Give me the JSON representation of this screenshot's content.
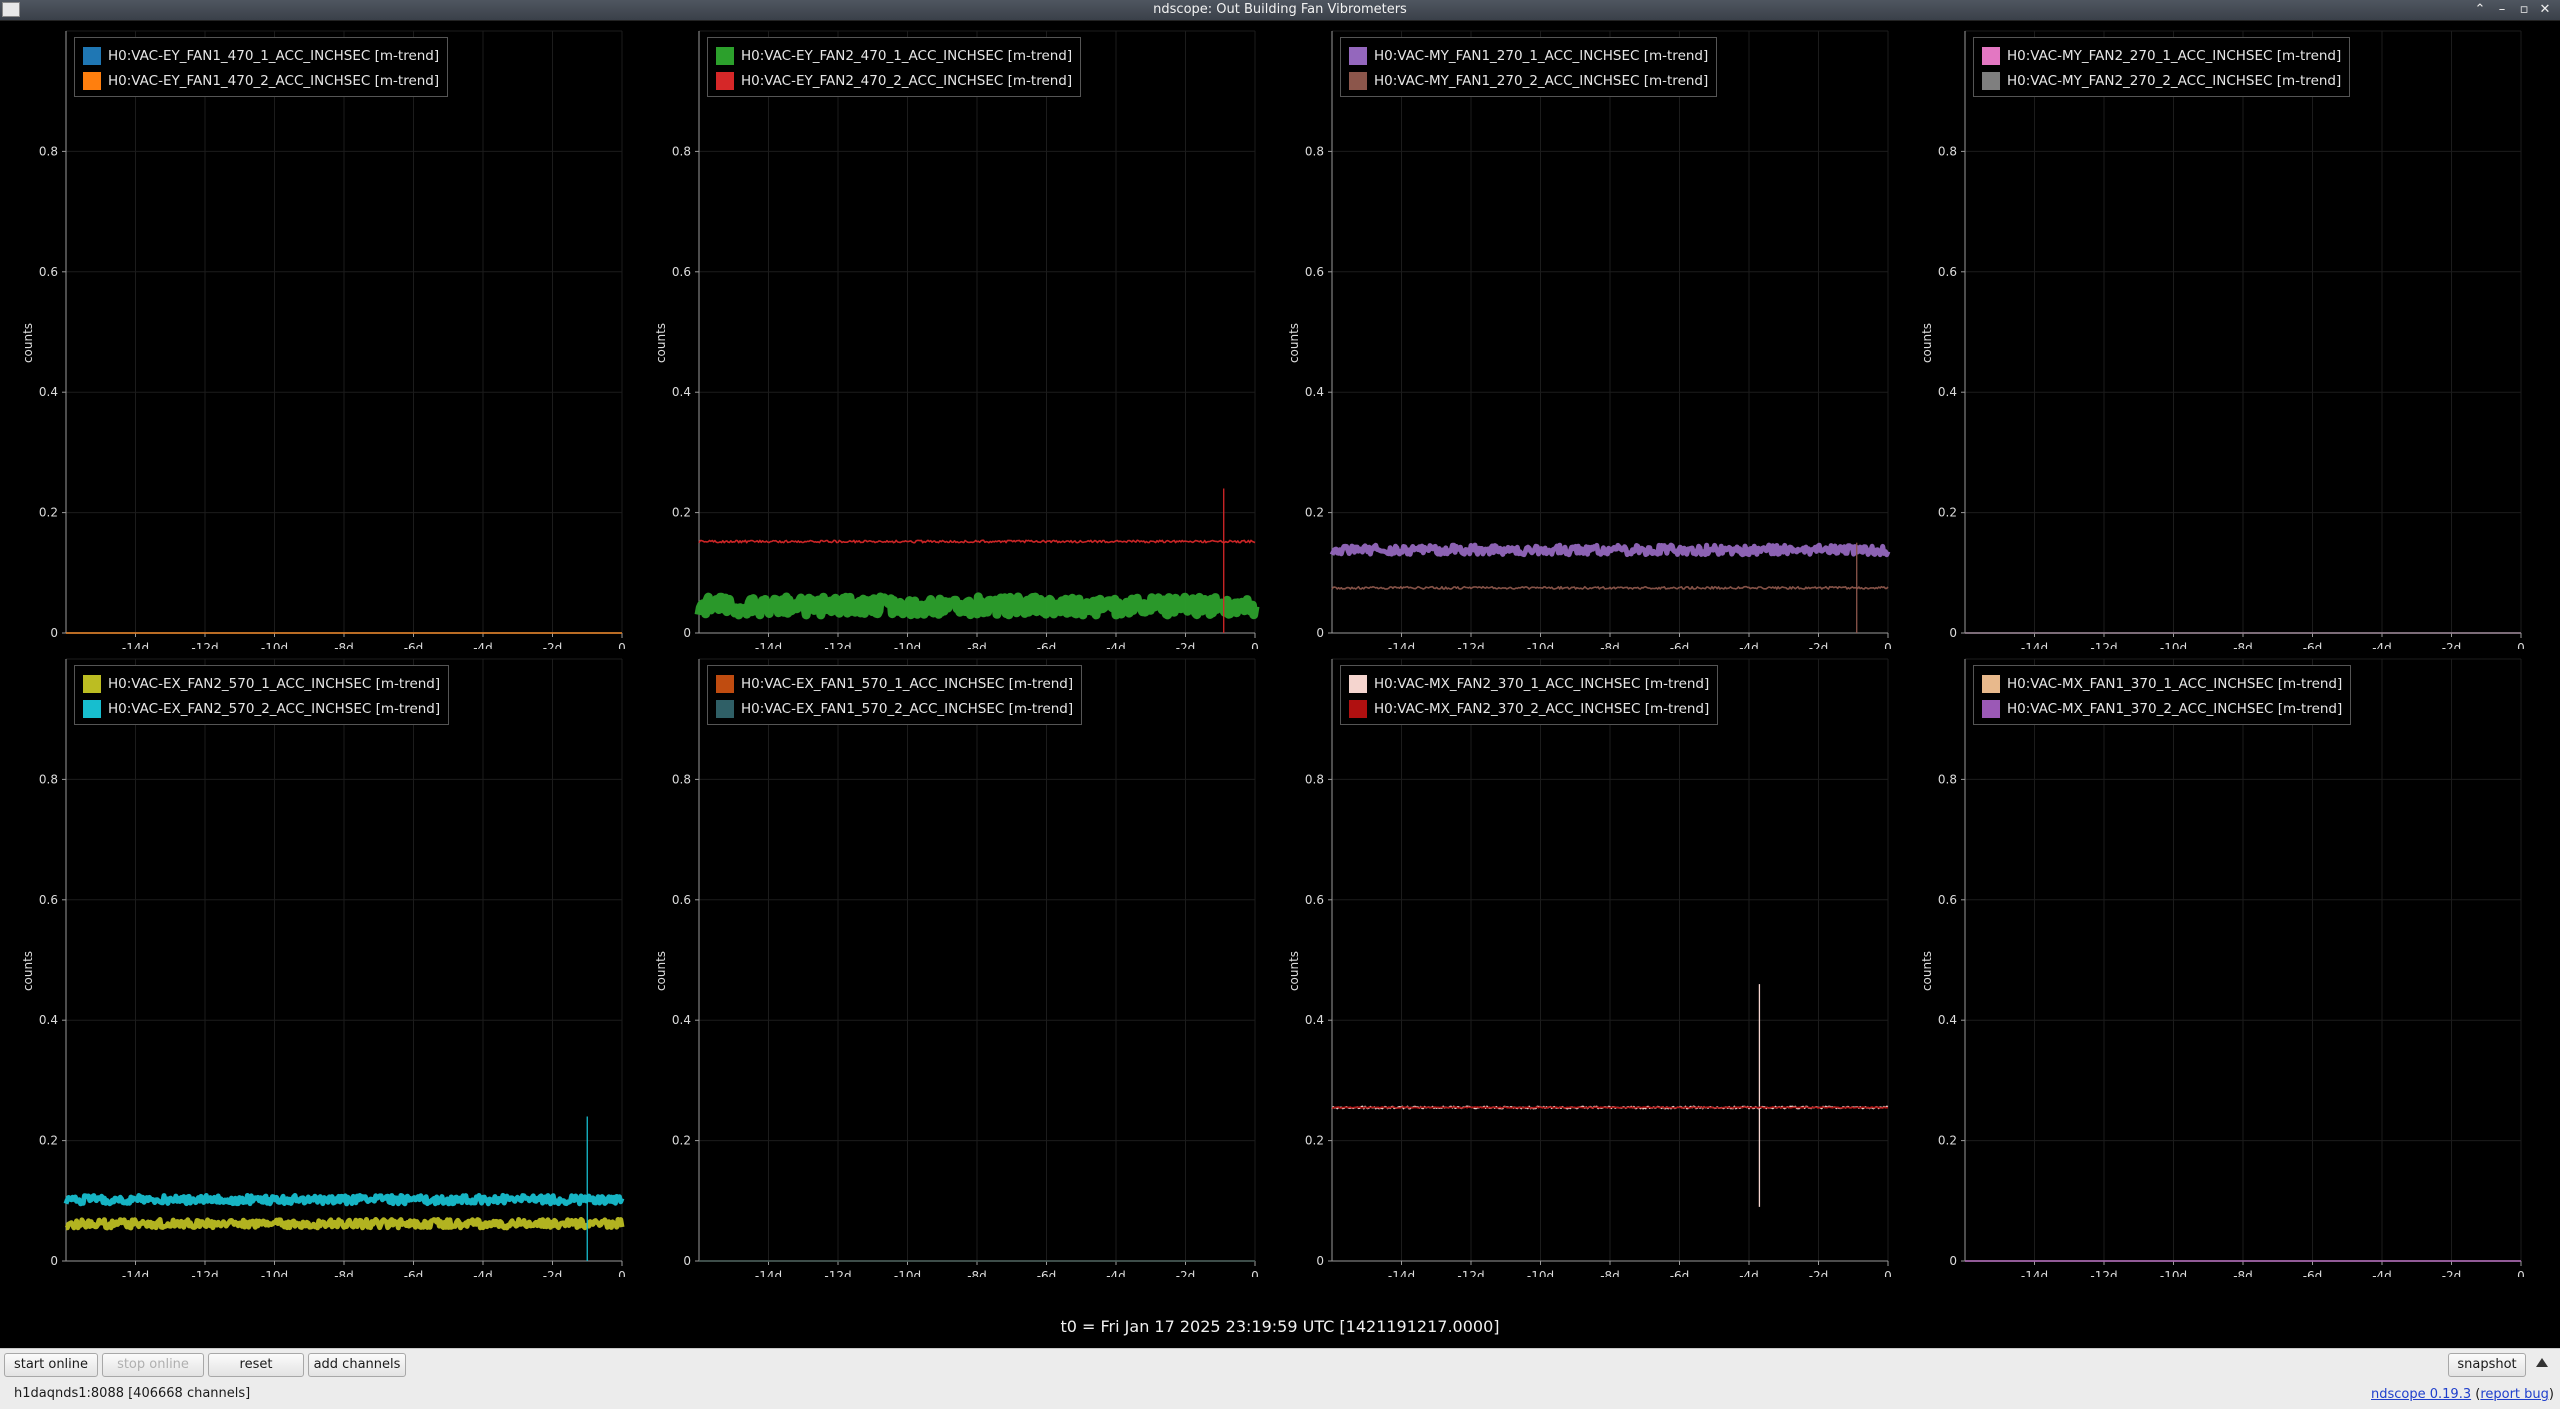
{
  "window": {
    "title": "ndscope: Out Building Fan Vibrometers"
  },
  "axes": {
    "ylabel": "counts",
    "ylim": [
      0,
      1.0
    ],
    "yticks": [
      "0",
      "0.2",
      "0.4",
      "0.6",
      "0.8"
    ],
    "xlim_days": [
      -16,
      0
    ],
    "xticks": [
      "-14d",
      "-12d",
      "-10d",
      "-8d",
      "-6d",
      "-4d",
      "-2d",
      "0"
    ]
  },
  "chart_data": [
    {
      "type": "line",
      "ylabel": "counts",
      "ylim": [
        0,
        1.0
      ],
      "x_range": [
        "-16d",
        "0"
      ],
      "series": [
        {
          "name": "H0:VAC-EY_FAN1_470_1_ACC_INCHSEC [m-trend]",
          "color": "#1f77b4",
          "level": 0.0,
          "noise": 0,
          "spike": null
        },
        {
          "name": "H0:VAC-EY_FAN1_470_2_ACC_INCHSEC [m-trend]",
          "color": "#ff7f0e",
          "level": 0.0,
          "noise": 0,
          "spike": null
        }
      ]
    },
    {
      "type": "line",
      "ylabel": "counts",
      "ylim": [
        0,
        1.0
      ],
      "x_range": [
        "-16d",
        "0"
      ],
      "series": [
        {
          "name": "H0:VAC-EY_FAN2_470_1_ACC_INCHSEC [m-trend]",
          "color": "#2ca02c",
          "level": 0.045,
          "noise": 0.015,
          "spike": null
        },
        {
          "name": "H0:VAC-EY_FAN2_470_2_ACC_INCHSEC [m-trend]",
          "color": "#d62728",
          "level": 0.152,
          "noise": 0.002,
          "spike": {
            "x": -0.9,
            "y0": 0.0,
            "y1": 0.24
          }
        }
      ]
    },
    {
      "type": "line",
      "ylabel": "counts",
      "ylim": [
        0,
        1.0
      ],
      "x_range": [
        "-16d",
        "0"
      ],
      "series": [
        {
          "name": "H0:VAC-MY_FAN1_270_1_ACC_INCHSEC [m-trend]",
          "color": "#9467bd",
          "level": 0.138,
          "noise": 0.008,
          "spike": null
        },
        {
          "name": "H0:VAC-MY_FAN1_270_2_ACC_INCHSEC [m-trend]",
          "color": "#8c564b",
          "level": 0.075,
          "noise": 0.002,
          "spike": {
            "x": -0.9,
            "y0": 0.0,
            "y1": 0.15
          }
        }
      ]
    },
    {
      "type": "line",
      "ylabel": "counts",
      "ylim": [
        0,
        1.0
      ],
      "x_range": [
        "-16d",
        "0"
      ],
      "series": [
        {
          "name": "H0:VAC-MY_FAN2_270_1_ACC_INCHSEC [m-trend]",
          "color": "#e377c2",
          "level": 0.0,
          "noise": 0,
          "spike": null
        },
        {
          "name": "H0:VAC-MY_FAN2_270_2_ACC_INCHSEC [m-trend]",
          "color": "#7f7f7f",
          "level": 0.0,
          "noise": 0,
          "spike": null
        }
      ]
    },
    {
      "type": "line",
      "ylabel": "counts",
      "ylim": [
        0,
        1.0
      ],
      "x_range": [
        "-16d",
        "0"
      ],
      "series": [
        {
          "name": "H0:VAC-EX_FAN2_570_1_ACC_INCHSEC [m-trend]",
          "color": "#bcbd22",
          "level": 0.062,
          "noise": 0.007,
          "spike": null
        },
        {
          "name": "H0:VAC-EX_FAN2_570_2_ACC_INCHSEC [m-trend]",
          "color": "#17becf",
          "level": 0.102,
          "noise": 0.007,
          "spike": {
            "x": -1.0,
            "y0": 0.0,
            "y1": 0.24
          }
        }
      ]
    },
    {
      "type": "line",
      "ylabel": "counts",
      "ylim": [
        0,
        1.0
      ],
      "x_range": [
        "-16d",
        "0"
      ],
      "series": [
        {
          "name": "H0:VAC-EX_FAN1_570_1_ACC_INCHSEC [m-trend]",
          "color": "#c04c10",
          "level": 0.0,
          "noise": 0,
          "spike": null
        },
        {
          "name": "H0:VAC-EX_FAN1_570_2_ACC_INCHSEC [m-trend]",
          "color": "#2f5f66",
          "level": 0.0,
          "noise": 0,
          "spike": null
        }
      ]
    },
    {
      "type": "line",
      "ylabel": "counts",
      "ylim": [
        0,
        1.0
      ],
      "x_range": [
        "-16d",
        "0"
      ],
      "series": [
        {
          "name": "H0:VAC-MX_FAN2_370_1_ACC_INCHSEC [m-trend]",
          "color": "#f5d5cf",
          "level": 0.255,
          "noise": 0.002,
          "spike": {
            "x": -3.7,
            "y0": 0.09,
            "y1": 0.46
          }
        },
        {
          "name": "H0:VAC-MX_FAN2_370_2_ACC_INCHSEC [m-trend]",
          "color": "#b01010",
          "level": 0.255,
          "noise": 0.001,
          "spike": null
        }
      ]
    },
    {
      "type": "line",
      "ylabel": "counts",
      "ylim": [
        0,
        1.0
      ],
      "x_range": [
        "-16d",
        "0"
      ],
      "series": [
        {
          "name": "H0:VAC-MX_FAN1_370_1_ACC_INCHSEC [m-trend]",
          "color": "#e8b98c",
          "level": 0.0,
          "noise": 0,
          "spike": null
        },
        {
          "name": "H0:VAC-MX_FAN1_370_2_ACC_INCHSEC [m-trend]",
          "color": "#9b59b6",
          "level": 0.0,
          "noise": 0,
          "spike": null
        }
      ]
    }
  ],
  "time_label": "t0 = Fri Jan 17 2025 23:19:59 UTC [1421191217.0000]",
  "controls": {
    "start_online": "start online",
    "stop_online": "stop online",
    "reset": "reset",
    "add_channels": "add channels",
    "snapshot": "snapshot"
  },
  "status": {
    "server": "h1daqnds1:8088  [406668 channels]",
    "version_link": "ndscope 0.19.3",
    "report_bug": "report bug"
  }
}
